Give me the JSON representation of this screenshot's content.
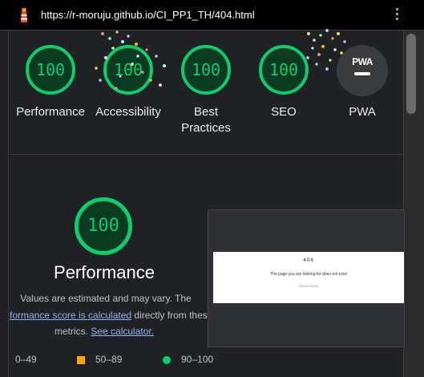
{
  "browser": {
    "url": "https://r-moruju.github.io/CI_PP1_TH/404.html"
  },
  "summary": {
    "categories": [
      {
        "label": "Performance",
        "score": "100"
      },
      {
        "label": "Accessibility",
        "score": "100"
      },
      {
        "label": "Best Practices",
        "score": "100"
      },
      {
        "label": "SEO",
        "score": "100"
      },
      {
        "label": "PWA",
        "badge": "PWA"
      }
    ]
  },
  "performance": {
    "score": "100",
    "title": "Performance",
    "desc_line1": "Values are estimated and may vary. The",
    "desc_link1": "formance score is calculated",
    "desc_line2_rest": " directly from these",
    "desc_line3_prefix": "metrics. ",
    "desc_link2": "See calculator.",
    "legend": [
      {
        "range": "0–49",
        "color": "#ff4e42"
      },
      {
        "range": "50–89",
        "color": "#ffa400"
      },
      {
        "range": "90–100",
        "color": "#0cce6b"
      }
    ]
  },
  "screenshot": {
    "heading": "404",
    "message": "The page you are looking for does not exist",
    "link": "Return Home"
  },
  "colors": {
    "pass": "#0cce6b",
    "average": "#ffa400",
    "fail": "#ff4e42",
    "link": "#8ab4f8",
    "background": "#202124"
  }
}
